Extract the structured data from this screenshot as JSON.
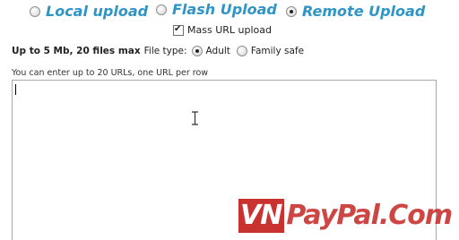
{
  "upload_modes": {
    "local": {
      "label": "Local upload",
      "selected": false
    },
    "flash": {
      "label": "Flash Upload",
      "selected": false
    },
    "remote": {
      "label": "Remote Upload",
      "selected": true
    }
  },
  "mass_url": {
    "label": "Mass URL upload",
    "checked": true
  },
  "options": {
    "limits": "Up to 5 Mb, 20 files max",
    "file_type_label": "File type:",
    "adult": {
      "label": "Adult",
      "selected": true
    },
    "family_safe": {
      "label": "Family safe",
      "selected": false
    }
  },
  "url_input": {
    "hint": "You can enter up to 20 URLs, one URL per row",
    "value": ""
  },
  "watermark": {
    "prefix": "VN",
    "rest": "PayPal.Com"
  },
  "colors": {
    "accent": "#2f95c5",
    "watermark": "#c9332f"
  }
}
